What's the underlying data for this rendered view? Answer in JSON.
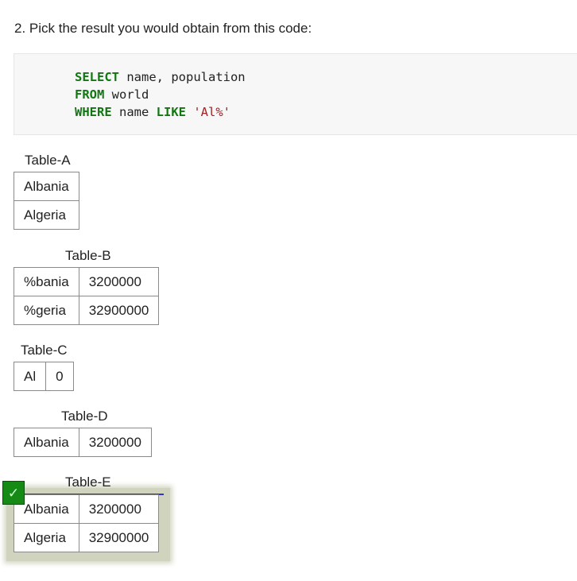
{
  "question": {
    "text": "2. Pick the result you would obtain from this code:"
  },
  "code": {
    "line1": {
      "kw": "SELECT",
      "rest": " name, population"
    },
    "line2": {
      "kw": "FROM",
      "rest": " world"
    },
    "line3": {
      "kw": "WHERE",
      "mid": " name ",
      "kw2": "LIKE",
      "space": " ",
      "str": "'Al%'"
    }
  },
  "options": [
    {
      "label": "Table-A",
      "rows": [
        [
          "Albania"
        ],
        [
          "Algeria"
        ]
      ]
    },
    {
      "label": "Table-B",
      "rows": [
        [
          "%bania",
          "3200000"
        ],
        [
          "%geria",
          "32900000"
        ]
      ]
    },
    {
      "label": "Table-C",
      "rows": [
        [
          "Al",
          "0"
        ]
      ]
    },
    {
      "label": "Table-D",
      "rows": [
        [
          "Albania",
          "3200000"
        ]
      ]
    },
    {
      "label": "Table-E",
      "rows": [
        [
          "Albania",
          "3200000"
        ],
        [
          "Algeria",
          "32900000"
        ]
      ]
    }
  ],
  "selected": {
    "option": "Table-E",
    "check_glyph": "✓",
    "icon": "checkmark-icon",
    "accent_color": "#158a15"
  }
}
